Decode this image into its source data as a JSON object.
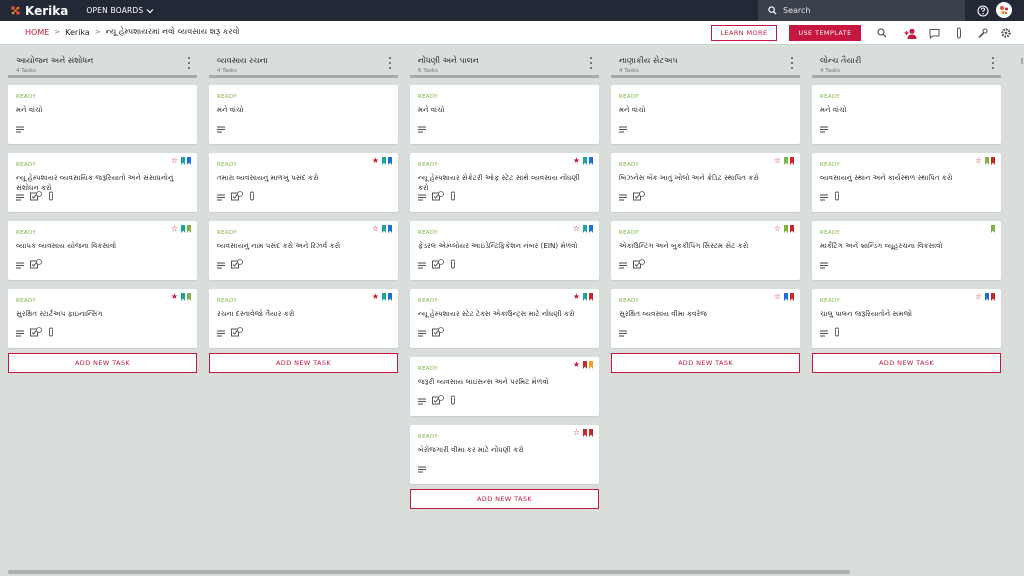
{
  "app": {
    "logo_text": "Kerika",
    "boards_menu": "OPEN BOARDS",
    "search_placeholder": "Search"
  },
  "breadcrumb": {
    "home": "HOME",
    "org": "Kerika",
    "board": "ન્યૂ હેમ્પશાયરમાં નવો વ્યવસાય શરૂ કરવો"
  },
  "buttons": {
    "learn_more": "LEARN MORE",
    "use_template": "USE TEMPLATE"
  },
  "colors": {
    "accent": "#c5173f",
    "topbar": "#222835",
    "ready": "#7cb342",
    "canvas": "#d9dedb"
  },
  "add_task_label": "ADD NEW TASK",
  "columns": [
    {
      "title": "આયોજન અને સંશોધન",
      "count": "4 Tasks",
      "cards": [
        {
          "status": "READY",
          "title": "મને વાંચો",
          "flags": [],
          "icons": [
            "description-icon"
          ]
        },
        {
          "status": "READY",
          "title": "ન્યૂ હેમ્પશાયર વ્યવસાયિક જરૂરિયાતો અને સંસાધનોનું સંશોધન કરો",
          "flags": [
            "star-outline",
            "teal",
            "blue"
          ],
          "icons": [
            "description-icon",
            "checklist-icon",
            "attachment-icon"
          ]
        },
        {
          "status": "READY",
          "title": "વ્યાપક વ્યવસાય યોજના વિકસાવો",
          "flags": [
            "star-outline",
            "teal",
            "green"
          ],
          "icons": [
            "description-icon",
            "checklist-icon"
          ]
        },
        {
          "status": "READY",
          "title": "સુરક્ષિત સ્ટાર્ટઅપ ફાઇનાન્સિંગ",
          "flags": [
            "star-filled",
            "teal",
            "green"
          ],
          "icons": [
            "description-icon",
            "checklist-icon",
            "attachment-icon"
          ]
        }
      ]
    },
    {
      "title": "વ્યવસાય રચના",
      "count": "4 Tasks",
      "cards": [
        {
          "status": "READY",
          "title": "મને વાંચો",
          "flags": [],
          "icons": [
            "description-icon"
          ]
        },
        {
          "status": "READY",
          "title": "તમારા વ્યવસાયનું માળખું પસંદ કરો",
          "flags": [
            "star-filled",
            "teal",
            "blue"
          ],
          "icons": [
            "description-icon",
            "checklist-icon",
            "attachment-icon"
          ]
        },
        {
          "status": "READY",
          "title": "વ્યવસાયનું નામ પસંદ કરો અને રિઝર્વ કરો",
          "flags": [
            "star-outline",
            "teal",
            "blue"
          ],
          "icons": [
            "description-icon",
            "checklist-icon"
          ]
        },
        {
          "status": "READY",
          "title": "રચના દસ્તાવેજો તૈયાર કરો",
          "flags": [
            "star-filled",
            "teal",
            "blue"
          ],
          "icons": [
            "description-icon",
            "checklist-icon"
          ]
        }
      ]
    },
    {
      "title": "નોંધણી અને પાલન",
      "count": "6 Tasks",
      "cards": [
        {
          "status": "READY",
          "title": "મને વાંચો",
          "flags": [],
          "icons": [
            "description-icon"
          ]
        },
        {
          "status": "READY",
          "title": "ન્યૂ હેમ્પશાયર સેક્રેટરી ઓફ સ્ટેટ સાથે વ્યવસાય નોંધણી કરો",
          "flags": [
            "star-filled",
            "teal",
            "blue"
          ],
          "icons": [
            "description-icon",
            "checklist-icon",
            "attachment-icon"
          ]
        },
        {
          "status": "READY",
          "title": "ફેડરલ એમ્પ્લોયર આઇડેન્ટિફિકેશન નંબર (EIN) મેળવો",
          "flags": [
            "star-outline",
            "teal",
            "blue"
          ],
          "icons": [
            "description-icon",
            "checklist-icon",
            "attachment-icon"
          ]
        },
        {
          "status": "READY",
          "title": "ન્યૂ હેમ્પશાયર સ્ટેટ ટેક્સ એકાઉન્ટ્સ માટે નોંધણી કરો",
          "flags": [
            "star-filled",
            "teal",
            "red"
          ],
          "icons": [
            "description-icon",
            "checklist-icon"
          ]
        },
        {
          "status": "READY",
          "title": "જરૂરી વ્યવસાય લાઇસન્સ અને પરમિટ મેળવો",
          "flags": [
            "star-filled",
            "red",
            "orange"
          ],
          "icons": [
            "description-icon",
            "checklist-icon",
            "attachment-icon"
          ]
        },
        {
          "status": "READY",
          "title": "બેરોજગારી વીમા કર માટે નોંધણી કરો",
          "flags": [
            "star-outline",
            "red",
            "red"
          ],
          "icons": [
            "description-icon"
          ]
        }
      ]
    },
    {
      "title": "નાણાકીય સેટઅપ",
      "count": "4 Tasks",
      "cards": [
        {
          "status": "READY",
          "title": "મને વાંચો",
          "flags": [],
          "icons": [
            "description-icon"
          ]
        },
        {
          "status": "READY",
          "title": "બિઝનેસ બેંક ખાતું ખોલો અને ક્રેડિટ સ્થાપિત કરો",
          "flags": [
            "star-outline",
            "green",
            "red"
          ],
          "icons": [
            "description-icon",
            "checklist-icon"
          ]
        },
        {
          "status": "READY",
          "title": "એકાઉન્ટિંગ અને બુકકીપિંગ સિસ્ટમ સેટ કરો",
          "flags": [
            "star-outline",
            "green",
            "red"
          ],
          "icons": [
            "description-icon",
            "checklist-icon"
          ]
        },
        {
          "status": "READY",
          "title": "સુરક્ષિત વ્યવસાય વીમા કવરેજ",
          "flags": [
            "star-outline",
            "blue",
            "red"
          ],
          "icons": [
            "description-icon"
          ]
        }
      ]
    },
    {
      "title": "લોન્ચ તૈયારી",
      "count": "4 Tasks",
      "cards": [
        {
          "status": "READY",
          "title": "મને વાંચો",
          "flags": [],
          "icons": [
            "description-icon"
          ]
        },
        {
          "status": "READY",
          "title": "વ્યવસાયનું સ્થાન અને કાર્યસ્થળ સ્થાપિત કરો",
          "flags": [
            "star-outline",
            "green",
            "red"
          ],
          "icons": [
            "description-icon",
            "attachment-icon"
          ]
        },
        {
          "status": "READY",
          "title": "માર્કેટિંગ અને બ્રાન્ડિંગ વ્યૂહરચના વિકસાવો",
          "flags": [
            "green"
          ],
          "icons": [
            "description-icon"
          ]
        },
        {
          "status": "READY",
          "title": "ચાલુ પાલન જરૂરિયાતોને સમજો",
          "flags": [
            "star-outline",
            "blue",
            "red"
          ],
          "icons": [
            "description-icon",
            "attachment-icon"
          ]
        }
      ]
    }
  ]
}
